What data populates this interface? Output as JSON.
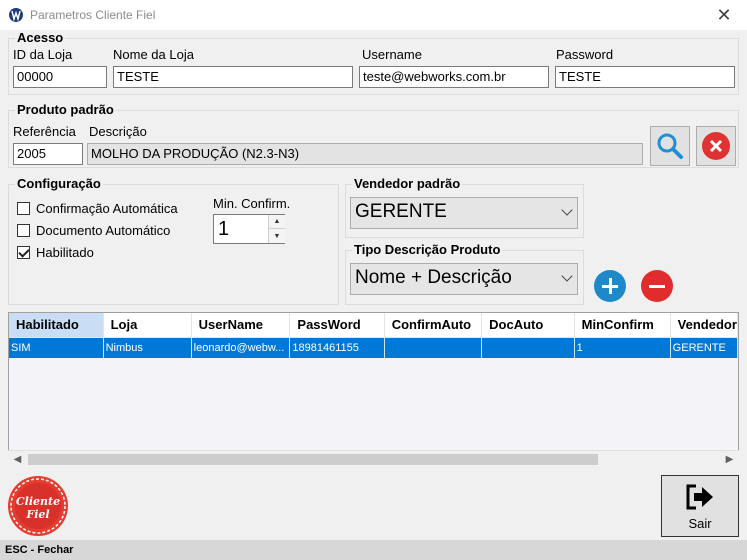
{
  "window": {
    "title": "Parametros Cliente Fiel",
    "close_glyph": "✕"
  },
  "acesso": {
    "legend": "Acesso",
    "id_label": "ID da Loja",
    "id_value": "00000",
    "nome_label": "Nome da Loja",
    "nome_value": "TESTE",
    "user_label": "Username",
    "user_value": "teste@webworks.com.br",
    "pass_label": "Password",
    "pass_value": "TESTE"
  },
  "produto": {
    "legend": "Produto padrão",
    "ref_label": "Referência",
    "ref_value": "2005",
    "desc_label": "Descrição",
    "desc_value": "MOLHO DA PRODUÇÃO (N2.3-N3)",
    "search_icon": "search-icon",
    "clear_icon": "close-circle-icon"
  },
  "config": {
    "legend": "Configuração",
    "opt_confirm": "Confirmação Automática",
    "opt_confirm_checked": false,
    "opt_doc": "Documento Automático",
    "opt_doc_checked": false,
    "opt_hab": "Habilitado",
    "opt_hab_checked": true,
    "min_label": "Min. Confirm.",
    "min_value": "1"
  },
  "vendedor": {
    "legend": "Vendedor padrão",
    "selected": "GERENTE"
  },
  "tipo": {
    "legend": "Tipo Descrição Produto",
    "selected": "Nome + Descrição"
  },
  "actions": {
    "add_icon": "plus-circle-icon",
    "remove_icon": "minus-circle-icon"
  },
  "grid": {
    "columns": [
      "Habilitado",
      "Loja",
      "UserName",
      "PassWord",
      "ConfirmAuto",
      "DocAuto",
      "MinConfirm",
      "Vendedor"
    ],
    "rows": [
      [
        "SIM",
        "Nimbus",
        "leonardo@webw...",
        "18981461155",
        "",
        "",
        "1",
        "GERENTE"
      ]
    ]
  },
  "logo": {
    "line1": "Cliente",
    "line2": "Fiel"
  },
  "exit": {
    "label": "Sair",
    "icon": "exit-icon"
  },
  "status": {
    "text": "ESC - Fechar"
  },
  "colors": {
    "accent": "#0078d7",
    "search_blue": "#1e8fd6",
    "danger": "#e03232",
    "add_blue": "#1e88c8",
    "remove_red": "#e02c2c"
  }
}
